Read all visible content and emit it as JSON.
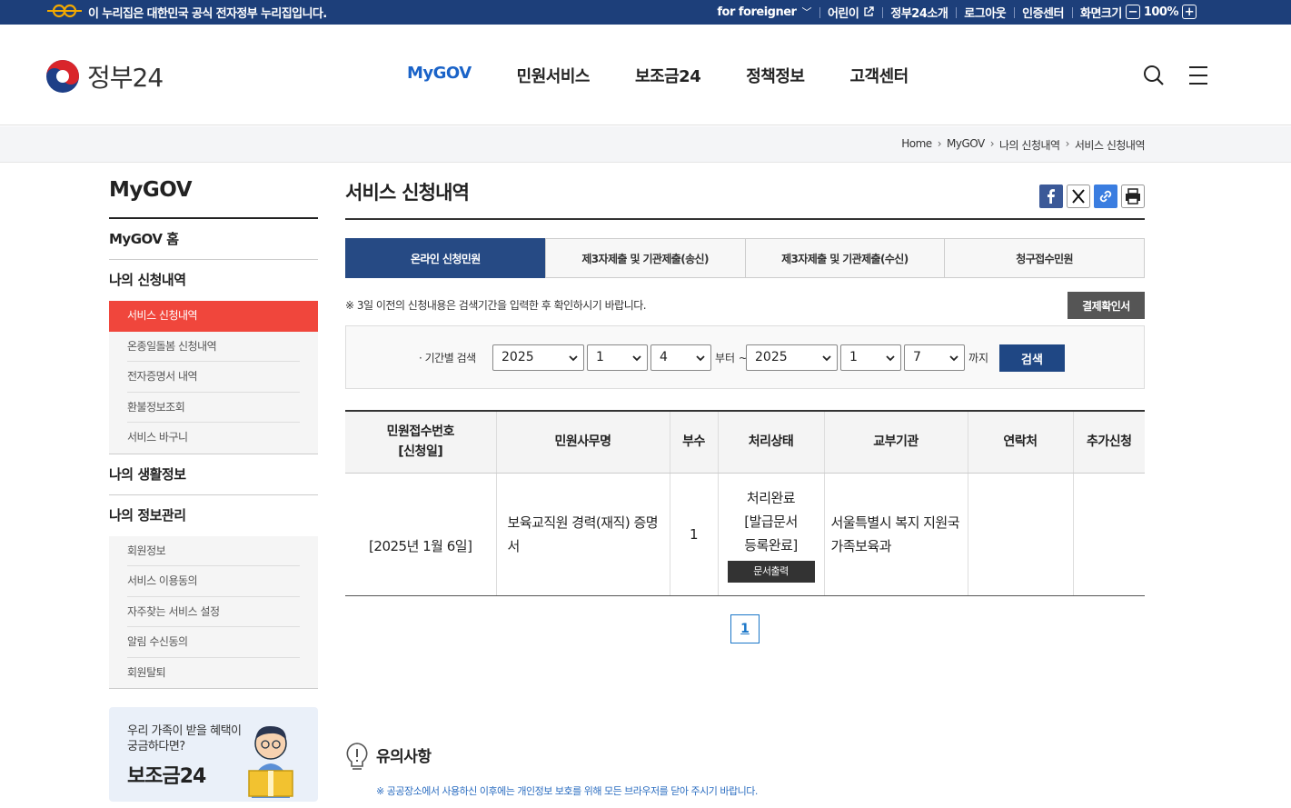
{
  "topbar": {
    "notice": "이 누리집은 대한민국 공식 전자정부 누리집입니다.",
    "foreigner": "for foreigner",
    "kids": "어린이",
    "about": "정부24소개",
    "logout": "로그아웃",
    "cert": "인증센터",
    "zoom_label": "화면크기",
    "zoom_value": "100%"
  },
  "header": {
    "brand": "정부24",
    "menus": [
      "MyGOV",
      "민원서비스",
      "보조금24",
      "정책정보",
      "고객센터"
    ]
  },
  "breadcrumb": [
    "Home",
    "MyGOV",
    "나의 신청내역",
    "서비스 신청내역"
  ],
  "sidebar": {
    "title": "MyGOV",
    "home": "MyGOV 홈",
    "group1": "나의 신청내역",
    "group1_items": [
      "서비스 신청내역",
      "온종일돌봄 신청내역",
      "전자증명서 내역",
      "환불정보조회",
      "서비스 바구니"
    ],
    "group2": "나의 생활정보",
    "group3": "나의 정보관리",
    "group3_items": [
      "회원정보",
      "서비스 이용동의",
      "자주찾는 서비스 설정",
      "알림 수신동의",
      "회원탈퇴"
    ],
    "banner_text": "우리 가족이 받을 혜택이 궁금하다면?",
    "banner_title": "보조금24"
  },
  "main": {
    "title": "서비스 신청내역",
    "tabs": [
      "온라인 신청민원",
      "제3자제출 및 기관제출(송신)",
      "제3자제출 및 기관제출(수신)",
      "청구접수민원"
    ],
    "notice": "※ 3일 이전의 신청내용은 검색기간을 입력한 후 확인하시기 바랍니다.",
    "pay_button": "결제확인서",
    "search": {
      "label": "· 기간별 검색",
      "from_year": "2025",
      "from_month": "1",
      "from_day": "4",
      "from_word": "부터 ~",
      "to_year": "2025",
      "to_month": "1",
      "to_day": "7",
      "to_word": "까지",
      "button": "검색"
    },
    "table": {
      "headers": [
        "민원접수번호\n[신청일]",
        "민원사무명",
        "부수",
        "처리상태",
        "교부기관",
        "연락처",
        "추가신청"
      ],
      "row": {
        "date": "[2025년 1월 6일]",
        "service": "보육교직원 경력(재직) 증명서",
        "copies": "1",
        "status": "처리완료",
        "status_detail": "[발급문서 등록완료]",
        "print_button": "문서출력",
        "agency": "서울특별시 복지 지원국 가족보육과"
      }
    },
    "page": "1",
    "caution_title": "유의사항",
    "caution_text": "※ 공공장소에서 사용하신 이후에는 개인정보 보호를 위해 모든 브라우저를 닫아 주시기 바랍니다."
  }
}
